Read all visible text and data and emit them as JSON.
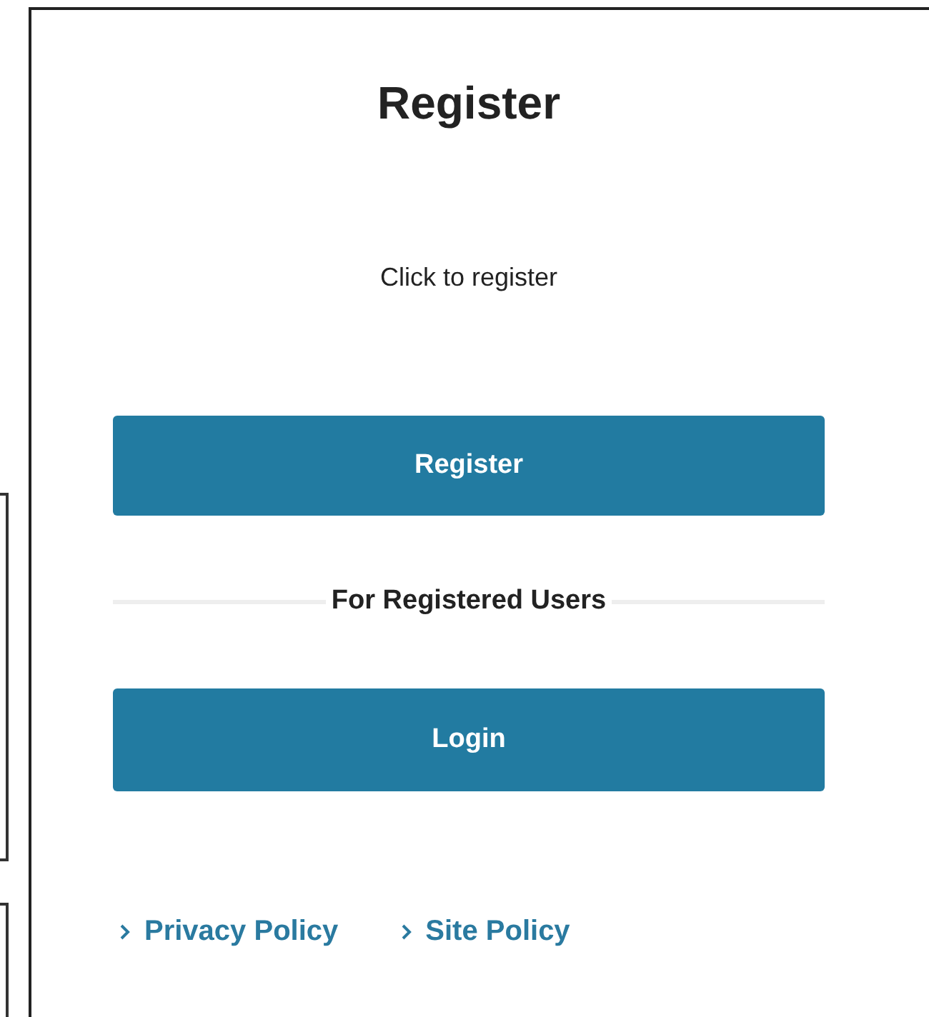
{
  "title": "Register",
  "subtitle": "Click to register",
  "register_button": {
    "label": "Register"
  },
  "divider": {
    "label": "For Registered Users"
  },
  "login_button": {
    "label": "Login"
  },
  "links": [
    {
      "label": "Privacy Policy"
    },
    {
      "label": "Site Policy"
    }
  ]
}
